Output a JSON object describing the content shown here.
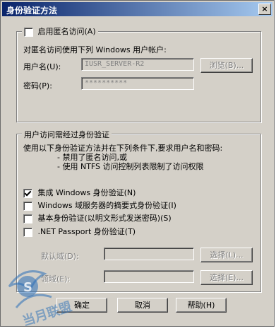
{
  "title": "身份验证方法",
  "close_glyph": "×",
  "anon": {
    "checkbox_label": "启用匿名访问(A)",
    "checked": false,
    "desc": "对匿名访问使用下列 Windows 用户帐户:",
    "username_label": "用户名(U):",
    "username_value": "IUSR_SERVER-R2",
    "browse_label": "浏览(B)...",
    "password_label": "密码(P):",
    "password_value": "**********"
  },
  "auth": {
    "legend": "用户访问需经过身份验证",
    "desc1": "使用以下身份验证方法并在下列条件下,要求用户名和密码:",
    "desc2": "- 禁用了匿名访问,或",
    "desc3": "- 使用 NTFS 访问控制列表限制了访问权限",
    "options": [
      {
        "label": "集成 Windows 身份验证(N)",
        "checked": true
      },
      {
        "label": "Windows 域服务器的摘要式身份验证(I)",
        "checked": false
      },
      {
        "label": "基本身份验证(以明文形式发送密码)(S)",
        "checked": false
      },
      {
        "label": ".NET Passport 身份验证(T)",
        "checked": false
      }
    ],
    "default_domain_label": "默认域(D):",
    "realm_label": "领域(E):",
    "select1_label": "选择(L)...",
    "select2_label": "选择(E)..."
  },
  "buttons": {
    "ok": "确定",
    "cancel": "取消",
    "help": "帮助(H)"
  },
  "watermark": "当月联盟"
}
